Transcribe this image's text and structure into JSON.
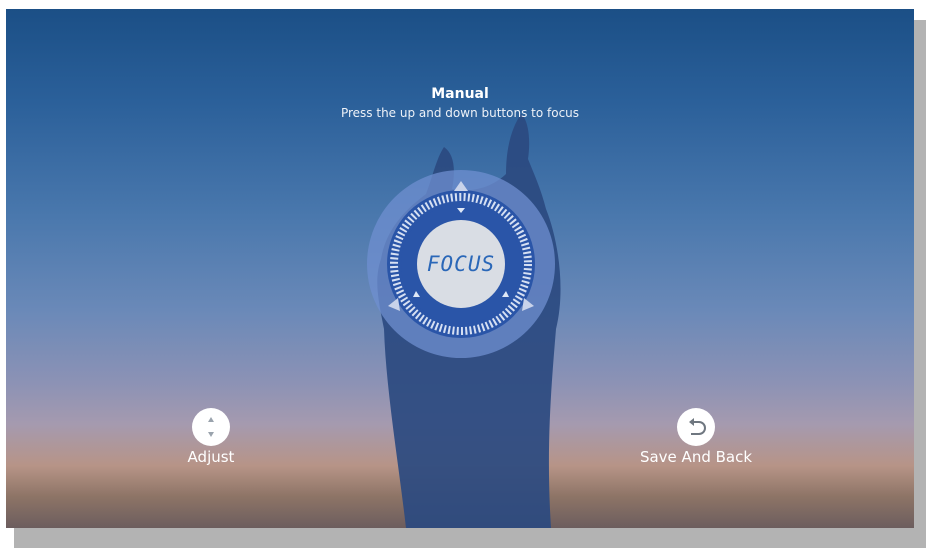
{
  "header": {
    "title": "Manual",
    "subtitle": "Press the up and down buttons to focus"
  },
  "dial": {
    "label": "FOCUS",
    "icon": "focus-dial-icon",
    "accent": "#2a67b8"
  },
  "controls": {
    "adjust": {
      "label": "Adjust",
      "icon": "up-down-arrows-icon"
    },
    "save_back": {
      "label": "Save And Back",
      "icon": "return-arrow-icon"
    }
  },
  "colors": {
    "sky_top": "#1b4f86",
    "silhouette": "#2b4a80",
    "button_bg": "#ffffff"
  }
}
